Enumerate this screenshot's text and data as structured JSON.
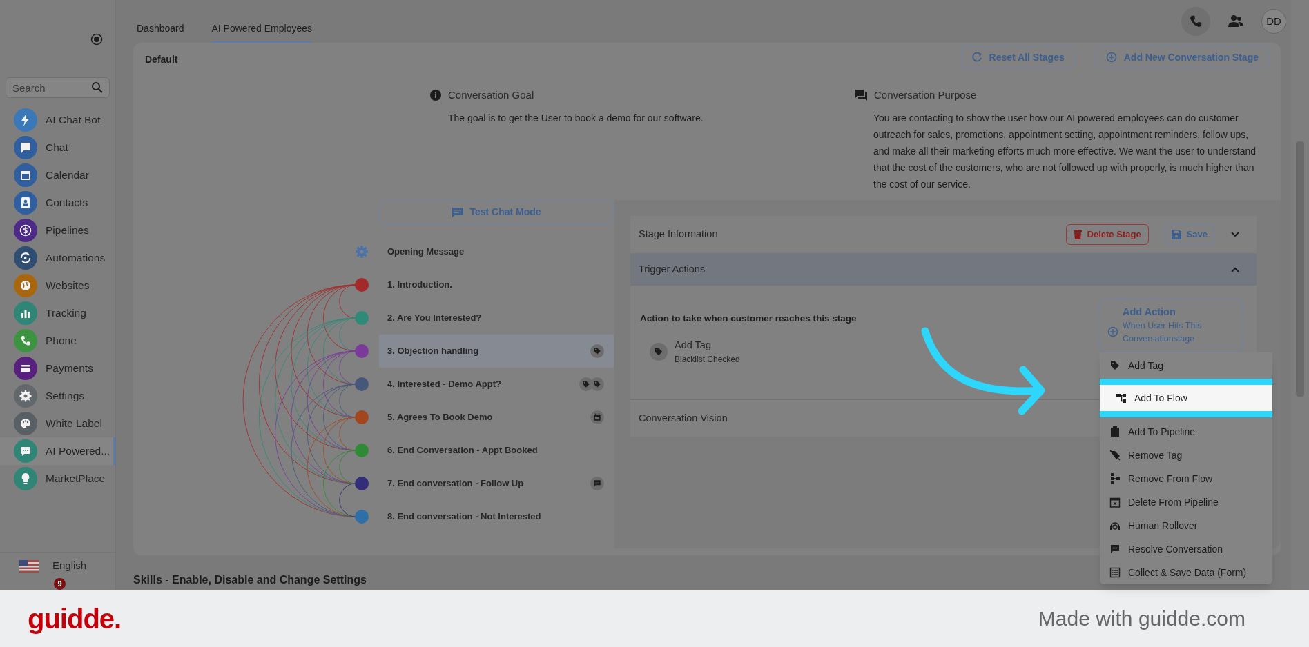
{
  "sidebar": {
    "search": {
      "placeholder": "Search"
    },
    "items": [
      {
        "label": "AI Chat Bot",
        "color": "#3a78b8",
        "selected": false
      },
      {
        "label": "Chat",
        "color": "#2f5f9e",
        "selected": false
      },
      {
        "label": "Calendar",
        "color": "#2f5f9e",
        "selected": false
      },
      {
        "label": "Contacts",
        "color": "#2f5f9e",
        "selected": false
      },
      {
        "label": "Pipelines",
        "color": "#4d2a88",
        "selected": false
      },
      {
        "label": "Automations",
        "color": "#2f4e72",
        "selected": false
      },
      {
        "label": "Websites",
        "color": "#a8670f",
        "selected": false
      },
      {
        "label": "Tracking",
        "color": "#2f8676",
        "selected": false
      },
      {
        "label": "Phone",
        "color": "#3c9440",
        "selected": false
      },
      {
        "label": "Payments",
        "color": "#58207e",
        "selected": false
      },
      {
        "label": "Settings",
        "color": "#62686c",
        "selected": false
      },
      {
        "label": "White Label",
        "color": "#586066",
        "selected": false
      },
      {
        "label": "AI Powered...",
        "color": "#2f8676",
        "selected": true
      },
      {
        "label": "MarketPlace",
        "color": "#2f8676",
        "selected": false
      }
    ],
    "language": "English",
    "notification_count": "9"
  },
  "tabs": [
    {
      "label": "Dashboard",
      "selected": false
    },
    {
      "label": "AI Powered Employees",
      "selected": true
    }
  ],
  "header": {
    "avatar": "DD"
  },
  "card": {
    "title": "Default",
    "buttons": [
      "Reset All Stages",
      "Add New Conversation Stage"
    ],
    "goal": {
      "title": "Conversation Goal",
      "text": "The goal is to get the User to book a demo for our software."
    },
    "purpose": {
      "title": "Conversation Purpose",
      "text": "You are contacting to show the user how our AI powered employees can do customer outreach for sales, promotions, appointment setting, appointment reminders, follow ups, and make all their marketing efforts much more effective. We want the user to understand that the cost of the customers, who are not followed up with properly, is much higher than the cost of our service."
    },
    "test_chat_button": "Test Chat Mode",
    "opening_message": "Opening Message",
    "stages": [
      {
        "label": "1. Introduction.",
        "color": "#a32a2a",
        "selected": false
      },
      {
        "label": "2. Are You Interested?",
        "color": "#2f8a78",
        "selected": false
      },
      {
        "label": "3. Objection handling",
        "color": "#7a3a9a",
        "selected": true,
        "badges": [
          {
            "kind": "tag"
          }
        ]
      },
      {
        "label": "4. Interested - Demo Appt?",
        "color": "#46577a",
        "selected": false,
        "badges": [
          {
            "kind": "tag"
          },
          {
            "kind": "tag"
          }
        ]
      },
      {
        "label": "5. Agrees To Book Demo",
        "color": "#a3461e",
        "selected": false,
        "badges": [
          {
            "kind": "calendar"
          }
        ]
      },
      {
        "label": "6. End Conversation - Appt Booked",
        "color": "#2f8a35",
        "selected": false
      },
      {
        "label": "7. End conversation - Follow Up",
        "color": "#332d7a",
        "selected": false,
        "badges": [
          {
            "kind": "chat"
          }
        ]
      },
      {
        "label": "8. End conversation - Not Interested",
        "color": "#2d6fa6",
        "selected": false
      }
    ],
    "stage_panel": {
      "sections": [
        {
          "title": "Stage Information",
          "expanded": false
        },
        {
          "title": "Trigger Actions",
          "expanded": true
        },
        {
          "title": "Conversation Vision"
        }
      ],
      "delete_button": "Delete Stage",
      "save_button": "Save",
      "action_prompt": "Action to take when customer reaches this stage",
      "add_action": {
        "title": "Add Action",
        "subtitle": "When User Hits This Conversationstage"
      },
      "actions": [
        {
          "title": "Add Tag",
          "detail": "Blacklist Checked"
        }
      ],
      "menu": [
        {
          "label": "Add Tag",
          "highlighted": false
        },
        {
          "label": "Add To Flow",
          "highlighted": true
        },
        {
          "label": "Add To Pipeline",
          "highlighted": false
        },
        {
          "label": "Remove Tag",
          "highlighted": false
        },
        {
          "label": "Remove From Flow",
          "highlighted": false
        },
        {
          "label": "Delete From Pipeline",
          "highlighted": false
        },
        {
          "label": "Human Rollover",
          "highlighted": false
        },
        {
          "label": "Resolve Conversation",
          "highlighted": false
        },
        {
          "label": "Collect & Save Data (Form)",
          "highlighted": false
        }
      ]
    }
  },
  "skills_heading": "Skills - Enable, Disable and Change Settings",
  "footer": {
    "brand": "guidde.",
    "credit": "Made with guidde.com"
  }
}
